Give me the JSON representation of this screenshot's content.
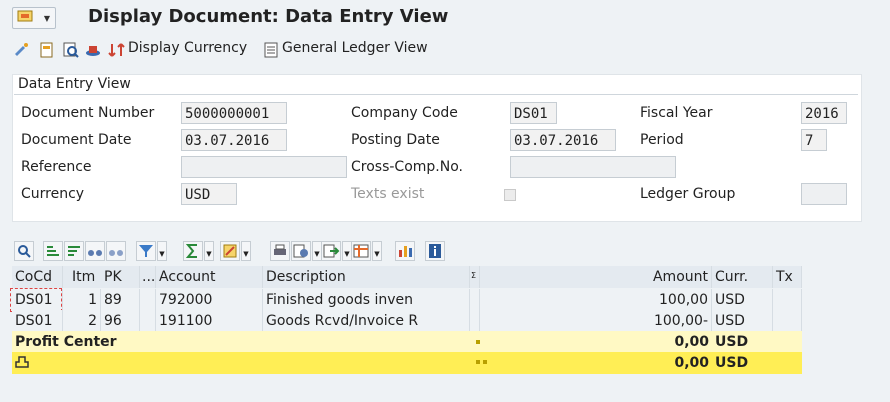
{
  "window": {
    "title": "Display Document: Data Entry View"
  },
  "toolbar": {
    "display_currency_label": "Display Currency",
    "general_ledger_label": "General Ledger View"
  },
  "header_panel": {
    "title": "Data Entry View",
    "document_number_label": "Document Number",
    "document_number_value": "5000000001",
    "company_code_label": "Company Code",
    "company_code_value": "DS01",
    "fiscal_year_label": "Fiscal Year",
    "fiscal_year_value": "2016",
    "document_date_label": "Document Date",
    "document_date_value": "03.07.2016",
    "posting_date_label": "Posting Date",
    "posting_date_value": "03.07.2016",
    "period_label": "Period",
    "period_value": "7",
    "reference_label": "Reference",
    "reference_value": "",
    "cross_comp_label": "Cross-Comp.No.",
    "cross_comp_value": "",
    "currency_label": "Currency",
    "currency_value": "USD",
    "texts_exist_label": "Texts exist",
    "ledger_group_label": "Ledger Group",
    "ledger_group_value": ""
  },
  "table": {
    "columns": [
      "CoCd",
      "Itm",
      "PK",
      "...",
      "Account",
      "Description",
      "Σ",
      "Amount",
      "Curr.",
      "Tx"
    ],
    "rows": [
      {
        "cocd": "DS01",
        "itm": "1",
        "pk": "89",
        "account": "792000",
        "description": "Finished goods inven",
        "amount": "100,00",
        "curr": "USD",
        "tx": ""
      },
      {
        "cocd": "DS01",
        "itm": "2",
        "pk": "96",
        "account": "191100",
        "description": "Goods Rcvd/Invoice R",
        "amount": "100,00-",
        "curr": "USD",
        "tx": ""
      }
    ],
    "subtotal": {
      "label": "Profit Center",
      "amount": "0,00",
      "curr": "USD"
    },
    "total": {
      "amount": "0,00",
      "curr": "USD"
    }
  },
  "colors": {
    "subtotal_bg": "#fff9c4",
    "total_bg": "#ffee55",
    "header_bg": "#e4eaf0"
  }
}
